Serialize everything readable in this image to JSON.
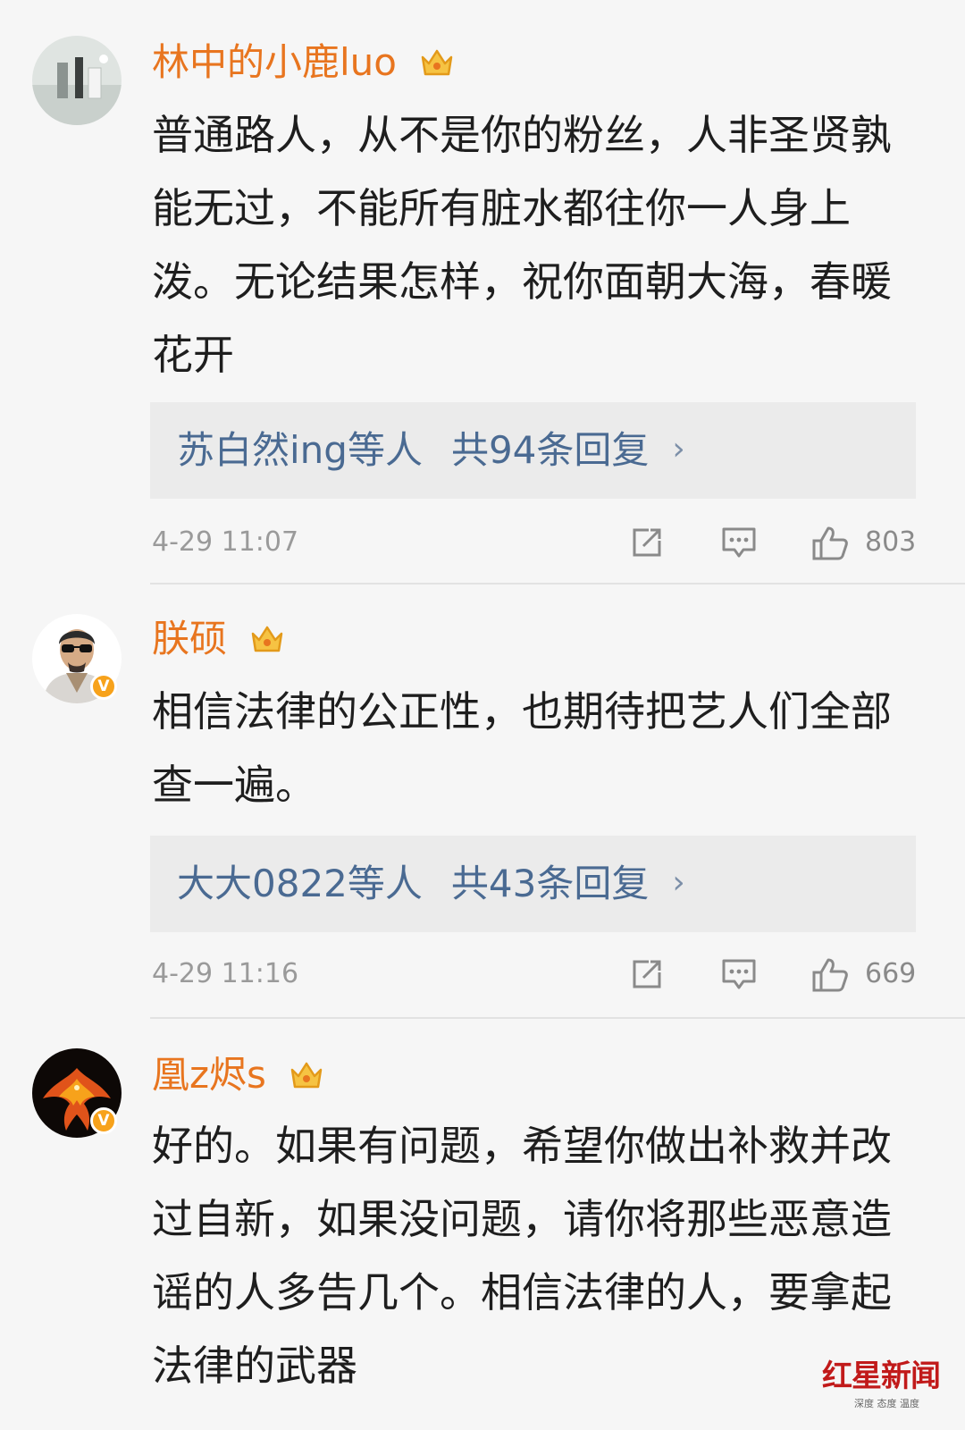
{
  "comments": [
    {
      "username": "林中的小鹿luo",
      "text": "普通路人，从不是你的粉丝，人非圣贤孰能无过，不能所有脏水都往你一人身上泼。无论结果怎样，祝你面朝大海，春暖花开",
      "replies_users": "苏白然ing等人",
      "replies_count": "共94条回复",
      "time": "4-29 11:07",
      "likes": "803"
    },
    {
      "username": "朕硕",
      "verified_badge": "V",
      "text": "相信法律的公正性，也期待把艺人们全部查一遍。",
      "replies_users": "大大0822等人",
      "replies_count": "共43条回复",
      "time": "4-29 11:16",
      "likes": "669"
    },
    {
      "username": "凰z烬s",
      "verified_badge": "V",
      "text": "好的。如果有问题，希望你做出补救并改过自新，如果没问题，请你将那些恶意造谣的人多告几个。相信法律的人，要拿起法律的武器"
    }
  ],
  "icons": {
    "crown": "crown-icon",
    "share": "share-icon",
    "comment": "comment-icon",
    "like": "thumbs-up-icon",
    "reply_chevron": "chevron-right-icon"
  },
  "reply_chevron_glyph": "›",
  "watermark": {
    "main": "红星新闻",
    "sub": "深度 态度 温度"
  },
  "colors": {
    "username": "#e8751f",
    "reply_link": "#4a6a92",
    "body_text": "#1e1e1e",
    "meta_text": "#9a9a9a",
    "verified_badge": "#f7a21b",
    "background": "#f6f6f6",
    "reply_box": "#ebebeb"
  }
}
